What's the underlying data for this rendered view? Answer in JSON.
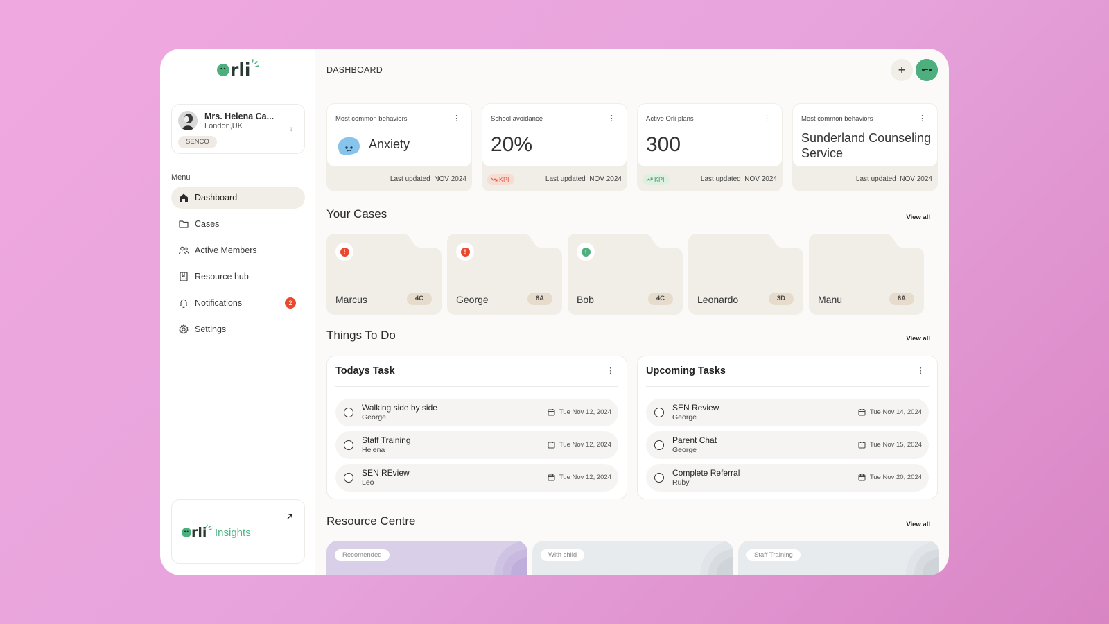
{
  "sidebar": {
    "logo_text": "orli",
    "profile": {
      "name": "Mrs. Helena Ca...",
      "location": "London,UK",
      "role": "SENCO"
    },
    "menu_title": "Menu",
    "items": [
      {
        "label": "Dashboard",
        "icon": "home-icon",
        "active": true
      },
      {
        "label": "Cases",
        "icon": "folder-icon"
      },
      {
        "label": "Active Members",
        "icon": "users-icon"
      },
      {
        "label": "Resource hub",
        "icon": "book-icon"
      },
      {
        "label": "Notifications",
        "icon": "bell-icon",
        "badge": "2"
      },
      {
        "label": "Settings",
        "icon": "gear-icon"
      }
    ],
    "insights": {
      "logo_text": "orli",
      "label": "Insights"
    }
  },
  "header": {
    "title": "DASHBOARD"
  },
  "kpis": [
    {
      "label": "Most common behaviors",
      "value": "Anxiety",
      "updated_label": "Last updated",
      "updated": "NOV 2024"
    },
    {
      "label": "School avoidance",
      "value": "20%",
      "chip": "KPI",
      "chip_trend": "down",
      "updated_label": "Last updated",
      "updated": "NOV 2024"
    },
    {
      "label": "Active Orli plans",
      "value": "300",
      "chip": "KPI",
      "chip_trend": "up",
      "updated_label": "Last updated",
      "updated": "NOV 2024"
    },
    {
      "label": "Most common behaviors",
      "value": "Sunderland Counseling Service",
      "updated_label": "Last updated",
      "updated": "NOV 2024"
    }
  ],
  "cases": {
    "title": "Your Cases",
    "view_all": "View all",
    "items": [
      {
        "name": "Marcus",
        "group": "4C",
        "status": "alert"
      },
      {
        "name": "George",
        "group": "6A",
        "status": "alert"
      },
      {
        "name": "Bob",
        "group": "4C",
        "status": "improving"
      },
      {
        "name": "Leonardo",
        "group": "3D",
        "status": "none"
      },
      {
        "name": "Manu",
        "group": "6A",
        "status": "none"
      }
    ]
  },
  "todo": {
    "title": "Things To Do",
    "view_all": "View all",
    "today": {
      "title": "Todays Task",
      "tasks": [
        {
          "name": "Walking side by side",
          "owner": "George",
          "date": "Tue Nov 12, 2024"
        },
        {
          "name": "Staff Training",
          "owner": "Helena",
          "date": "Tue Nov 12, 2024"
        },
        {
          "name": "SEN REview",
          "owner": "Leo",
          "date": "Tue Nov 12, 2024"
        }
      ]
    },
    "upcoming": {
      "title": "Upcoming Tasks",
      "tasks": [
        {
          "name": "SEN Review",
          "owner": "George",
          "date": "Tue Nov 14, 2024"
        },
        {
          "name": "Parent Chat",
          "owner": "George",
          "date": "Tue Nov 15, 2024"
        },
        {
          "name": "Complete Referral",
          "owner": "Ruby",
          "date": "Tue Nov 20, 2024"
        }
      ]
    }
  },
  "resources": {
    "title": "Resource Centre",
    "view_all": "View all",
    "items": [
      {
        "label": "Recomended",
        "color": "#d9cfe9"
      },
      {
        "label": "With child",
        "color": "#e8ebee"
      },
      {
        "label": "Staff Training",
        "color": "#e8ebee"
      }
    ]
  },
  "colors": {
    "brand_green": "#4caf7d",
    "alert_red": "#e8482d",
    "background_pink": "#e7a4dc",
    "case_folder": "#f1eee8"
  }
}
